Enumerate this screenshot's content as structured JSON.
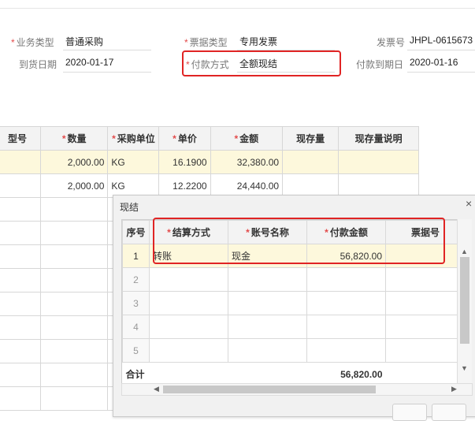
{
  "form": {
    "biz_type_label": "业务类型",
    "biz_type_value": "普通采购",
    "bill_type_label": "票据类型",
    "bill_type_value": "专用发票",
    "invoice_no_label": "发票号",
    "invoice_no_value": "JHPL-0615673",
    "arrival_date_label": "到货日期",
    "arrival_date_value": "2020-01-17",
    "pay_method_label": "付款方式",
    "pay_method_value": "全额现结",
    "pay_due_label": "付款到期日",
    "pay_due_value": "2020-01-16"
  },
  "grid": {
    "columns": [
      "型号",
      "数量",
      "采购单位",
      "单价",
      "金额",
      "现存量",
      "现存量说明"
    ],
    "rows": [
      [
        "",
        "2,000.00",
        "KG",
        "16.1900",
        "32,380.00",
        "",
        ""
      ],
      [
        "",
        "2,000.00",
        "KG",
        "12.2200",
        "24,440.00",
        "",
        ""
      ]
    ]
  },
  "popup": {
    "title": "现结",
    "close_glyph": "×",
    "columns": [
      "序号",
      "结算方式",
      "账号名称",
      "付款金额",
      "票据号"
    ],
    "rows": [
      [
        "1",
        "转账",
        "现金",
        "56,820.00",
        ""
      ],
      [
        "2",
        "",
        "",
        "",
        ""
      ],
      [
        "3",
        "",
        "",
        "",
        ""
      ],
      [
        "4",
        "",
        "",
        "",
        ""
      ],
      [
        "5",
        "",
        "",
        "",
        ""
      ]
    ],
    "total_label": "合计",
    "total_value": "56,820.00"
  },
  "icons": {
    "close": "close-icon",
    "scroll_up": "up-arrow-icon",
    "scroll_down": "down-arrow-icon",
    "scroll_left": "left-arrow-icon",
    "scroll_right": "right-arrow-icon"
  },
  "colors": {
    "highlight_box": "#e02424",
    "selected_row": "#fdf8dc",
    "required_star": "#e34b4b"
  }
}
